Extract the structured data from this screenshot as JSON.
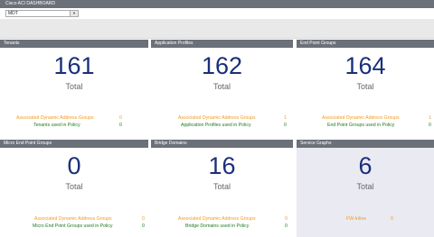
{
  "app": {
    "title": "Cisco ACI DASHBOARD"
  },
  "selector": {
    "value": "MDT",
    "arrow": "▼"
  },
  "panels": [
    {
      "header": "Tenants",
      "value": "161",
      "total": "Total",
      "stats": [
        {
          "label": "Associated Dynamic Address Groups",
          "value": "0",
          "color": "orange"
        },
        {
          "label": "Tenants used in Policy",
          "value": "0",
          "color": "green"
        }
      ]
    },
    {
      "header": "Application Profiles",
      "value": "162",
      "total": "Total",
      "stats": [
        {
          "label": "Associated Dynamic Address Groups",
          "value": "1",
          "color": "orange"
        },
        {
          "label": "Application Profiles used in Policy",
          "value": "0",
          "color": "green"
        }
      ]
    },
    {
      "header": "End Point Groups",
      "value": "164",
      "total": "Total",
      "stats": [
        {
          "label": "Associated Dynamic Address Groups",
          "value": "1",
          "color": "orange"
        },
        {
          "label": "End Point Groups used in Policy",
          "value": "0",
          "color": "green"
        }
      ]
    },
    {
      "header": "Micro End Point Groups",
      "value": "0",
      "total": "Total",
      "stats": [
        {
          "label": "Associated Dynamic Address Groups",
          "value": "0",
          "color": "orange"
        },
        {
          "label": "Micro End Point Groups used in Policy",
          "value": "0",
          "color": "green"
        }
      ]
    },
    {
      "header": "Bridge Domains",
      "value": "16",
      "total": "Total",
      "stats": [
        {
          "label": "Associated Dynamic Address Groups",
          "value": "0",
          "color": "orange"
        },
        {
          "label": "Bridge Domains used in Policy",
          "value": "0",
          "color": "green"
        }
      ]
    },
    {
      "header": "Service Graphs",
      "value": "6",
      "total": "Total",
      "stats": [
        {
          "label": "FW-Inline",
          "value": "0",
          "color": "orange"
        }
      ]
    }
  ],
  "colors": {
    "header_bg": "#6b7079",
    "number": "#1a2f7a",
    "orange": "#f39a1e",
    "green": "#1f7a1f",
    "shaded_panel": "#eaeaf2"
  }
}
